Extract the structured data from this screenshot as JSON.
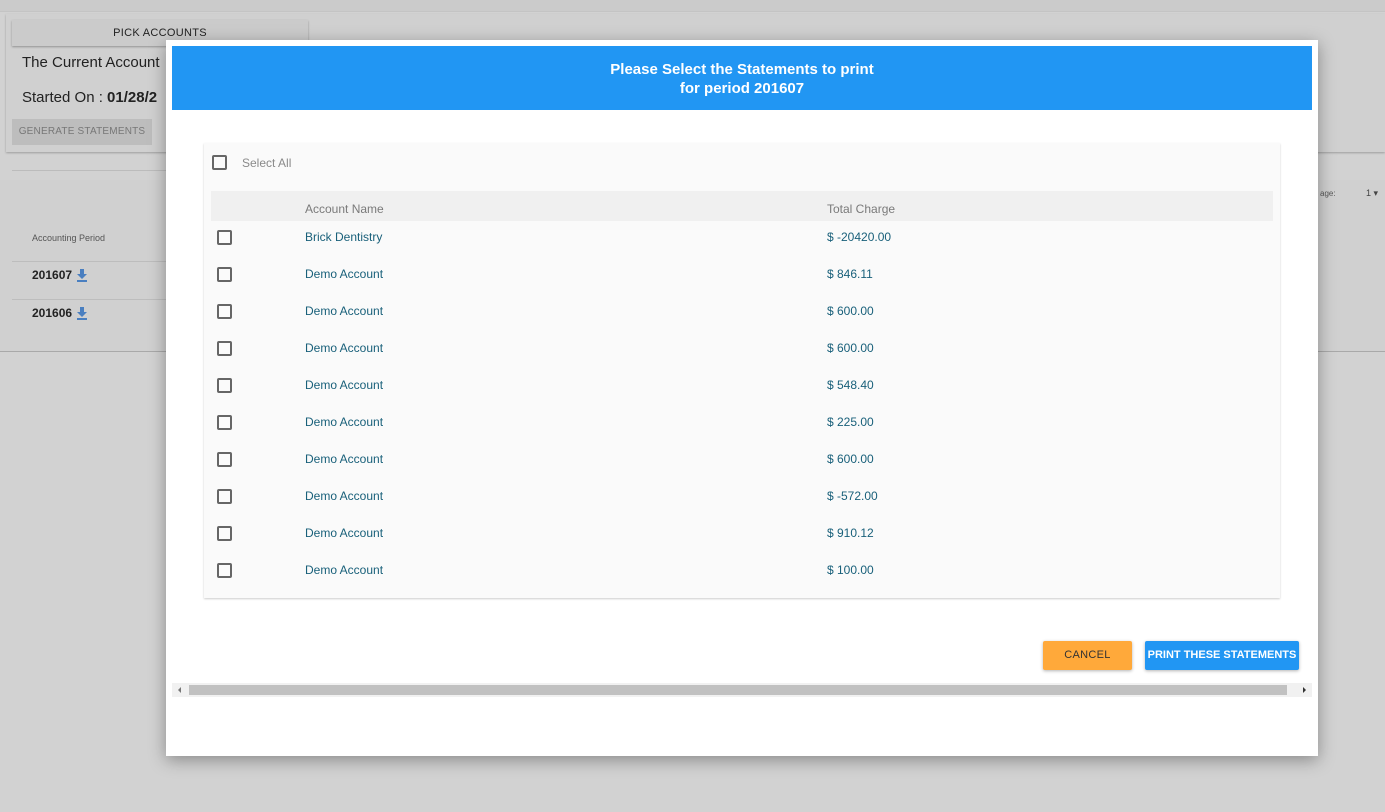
{
  "background": {
    "pick_accounts_label": "PICK ACCOUNTS",
    "current_account_text": "The Current Account",
    "started_on_label": "Started On : ",
    "started_on_value": "01/28/2",
    "generate_statements_label": "GENERATE STATEMENTS",
    "accounting_period_header": "Accounting Period",
    "periods": [
      "201607",
      "201606"
    ],
    "page_label": "age:",
    "page_number": "1"
  },
  "modal": {
    "title_line1": "Please Select the Statements to print",
    "title_line2": "for period 201607",
    "select_all_label": "Select All",
    "columns": {
      "account_name": "Account Name",
      "total_charge": "Total Charge"
    },
    "rows": [
      {
        "account_name": "Brick Dentistry",
        "total_charge": "$ -20420.00",
        "checked": false
      },
      {
        "account_name": "Demo Account",
        "total_charge": "$ 846.11",
        "checked": false
      },
      {
        "account_name": "Demo Account",
        "total_charge": "$ 600.00",
        "checked": false
      },
      {
        "account_name": "Demo Account",
        "total_charge": "$ 600.00",
        "checked": false
      },
      {
        "account_name": "Demo Account",
        "total_charge": "$ 548.40",
        "checked": false
      },
      {
        "account_name": "Demo Account",
        "total_charge": "$ 225.00",
        "checked": false
      },
      {
        "account_name": "Demo Account",
        "total_charge": "$ 600.00",
        "checked": false
      },
      {
        "account_name": "Demo Account",
        "total_charge": "$ -572.00",
        "checked": false
      },
      {
        "account_name": "Demo Account",
        "total_charge": "$ 910.12",
        "checked": false
      },
      {
        "account_name": "Demo Account",
        "total_charge": "$ 100.00",
        "checked": false
      }
    ],
    "cancel_label": "CANCEL",
    "print_label": "PRINT THESE STATEMENTS"
  },
  "colors": {
    "header_blue": "#2196f3",
    "cancel_orange": "#ffa93a",
    "link_teal": "#19607a"
  }
}
